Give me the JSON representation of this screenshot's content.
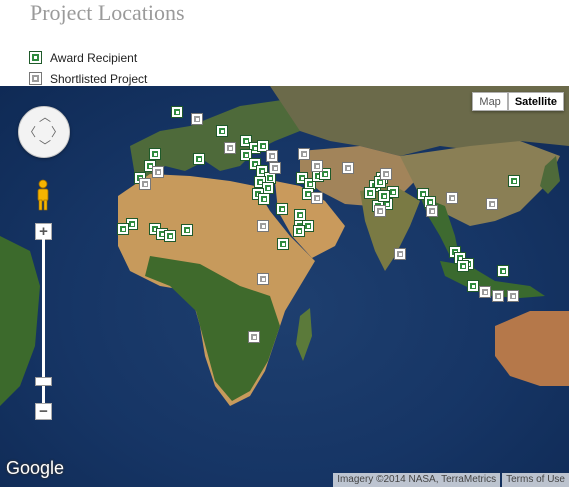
{
  "page": {
    "title": "Project Locations"
  },
  "legend": [
    {
      "label": "Award Recipient",
      "icon": "award-marker-icon",
      "color": "#2e8b3e"
    },
    {
      "label": "Shortlisted Project",
      "icon": "shortlisted-marker-icon",
      "color": "#9c9c9c"
    }
  ],
  "map": {
    "type_controls": {
      "map_label": "Map",
      "satellite_label": "Satellite",
      "active": "Satellite"
    },
    "zoom": {
      "in_label": "+",
      "out_label": "−"
    },
    "logo": "Google",
    "attribution": "Imagery ©2014 NASA, TerraMetrics",
    "terms_label": "Terms of Use",
    "colors": {
      "ocean": "#163565",
      "desert": "#c99a5c",
      "forest": "#3f6b2c"
    }
  }
}
